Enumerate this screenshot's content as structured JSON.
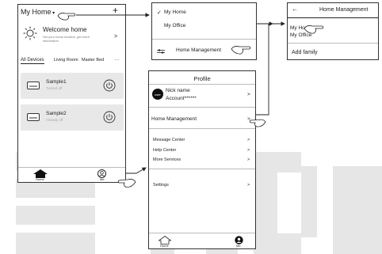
{
  "phone1": {
    "home_selector": "My Home",
    "add_icon": "+",
    "welcome_title": "Welcome home",
    "welcome_sub_line1": "Set your home location, get more",
    "welcome_sub_line2": "information",
    "welcome_chevron": ">",
    "tabs": [
      "All Devices",
      "Living Room",
      "Master Bed"
    ],
    "tabs_more": "···",
    "devices": [
      {
        "name": "Sample1",
        "status": "Turned off"
      },
      {
        "name": "Sample2",
        "status": "Already off"
      }
    ],
    "nav_home": "Home",
    "nav_me": "Me"
  },
  "dropdown": {
    "check": "✓",
    "item1": "My Home",
    "item2": "My Office",
    "manage": "Home Management"
  },
  "profile": {
    "title": "Profile",
    "nick": "Nick name",
    "account": "Account******",
    "account_chevron": ">",
    "home_mgmt": "Home Management",
    "home_mgmt_chevron": ">",
    "menu": [
      {
        "label": "Message Center",
        "chevron": ">"
      },
      {
        "label": "Help Center",
        "chevron": ">"
      },
      {
        "label": "More Services",
        "chevron": ">"
      }
    ],
    "settings": "Settings",
    "settings_chevron": ">",
    "nav_home": "Home",
    "nav_me": "Me"
  },
  "home_mgmt": {
    "back": "←",
    "title": "Home Management",
    "homes": [
      "My Home",
      "My Office"
    ],
    "add_family": "Add family"
  },
  "colors": {
    "watermark": "#e3e3e3",
    "card": "#e8e8e8",
    "separator": "#bbbbbb"
  }
}
